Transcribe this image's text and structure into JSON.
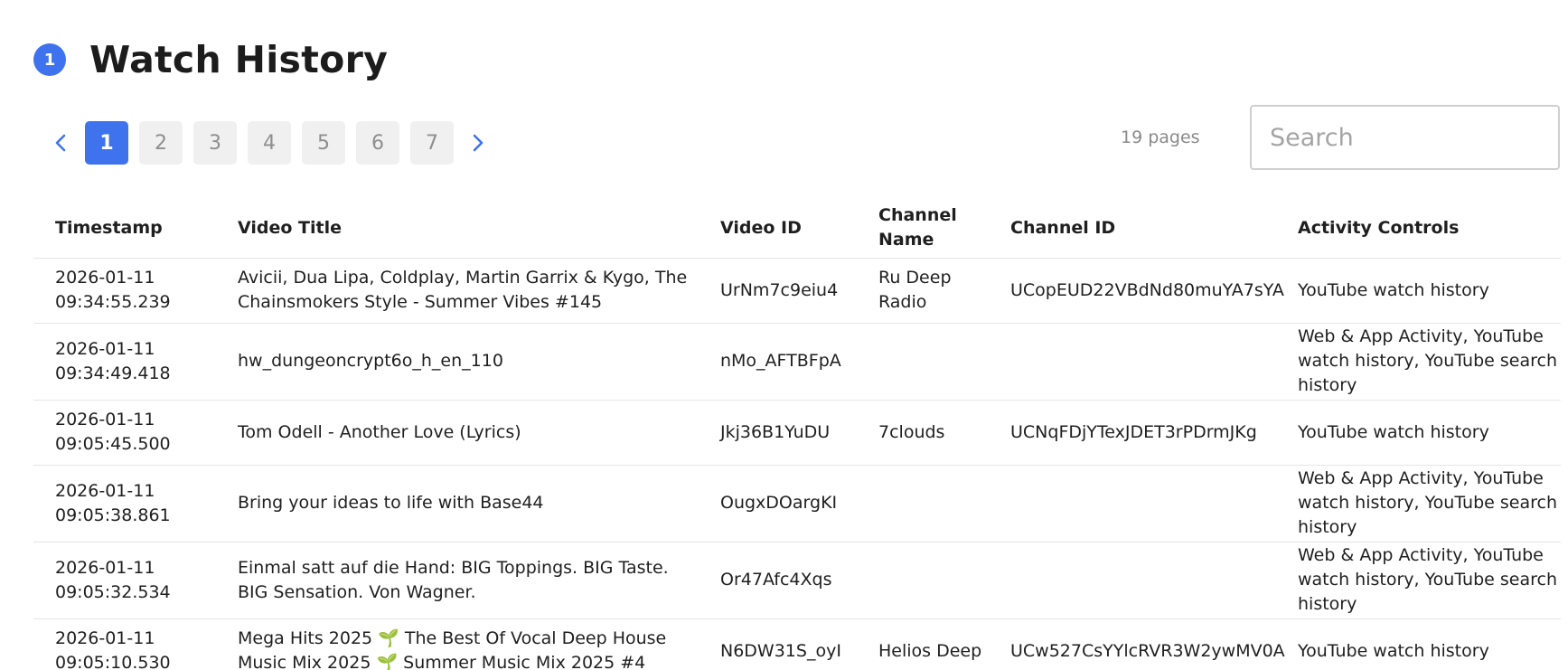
{
  "header": {
    "step": "1",
    "title": "Watch History"
  },
  "pagination": {
    "pages": [
      "1",
      "2",
      "3",
      "4",
      "5",
      "6",
      "7"
    ],
    "active_page": "1",
    "pages_count": "19 pages"
  },
  "search": {
    "placeholder": "Search",
    "value": ""
  },
  "colors": {
    "accent": "#3f73ee",
    "page_inactive_bg": "#f0f0f0"
  },
  "table": {
    "columns": [
      "Timestamp",
      "Video Title",
      "Video ID",
      "Channel Name",
      "Channel ID",
      "Activity Controls"
    ],
    "rows": [
      {
        "timestamp": "2026-01-11 09:34:55.239",
        "title": "Avicii, Dua Lipa, Coldplay, Martin Garrix & Kygo, The Chainsmokers Style - Summer Vibes #145",
        "video_id": "UrNm7c9eiu4",
        "channel_name": "Ru Deep Radio",
        "channel_id": "UCopEUD22VBdNd80muYA7sYA",
        "activity": "YouTube watch history"
      },
      {
        "timestamp": "2026-01-11 09:34:49.418",
        "title": "hw_dungeoncrypt6o_h_en_110",
        "video_id": "nMo_AFTBFpA",
        "channel_name": "",
        "channel_id": "",
        "activity": "Web & App Activity, YouTube watch history, YouTube search history"
      },
      {
        "timestamp": "2026-01-11 09:05:45.500",
        "title": "Tom Odell - Another Love (Lyrics)",
        "video_id": "Jkj36B1YuDU",
        "channel_name": "7clouds",
        "channel_id": "UCNqFDjYTexJDET3rPDrmJKg",
        "activity": "YouTube watch history"
      },
      {
        "timestamp": "2026-01-11 09:05:38.861",
        "title": "Bring your ideas to life with Base44",
        "video_id": "OugxDOargKI",
        "channel_name": "",
        "channel_id": "",
        "activity": "Web & App Activity, YouTube watch history, YouTube search history"
      },
      {
        "timestamp": "2026-01-11 09:05:32.534",
        "title": "Einmal satt auf die Hand: BIG Toppings. BIG Taste. BIG Sensation. Von Wagner.",
        "video_id": "Or47Afc4Xqs",
        "channel_name": "",
        "channel_id": "",
        "activity": "Web & App Activity, YouTube watch history, YouTube search history"
      },
      {
        "timestamp": "2026-01-11 09:05:10.530",
        "title": "Mega Hits 2025 🌱 The Best Of Vocal Deep House Music Mix 2025 🌱 Summer Music Mix 2025 #4",
        "video_id": "N6DW31S_oyI",
        "channel_name": "Helios Deep",
        "channel_id": "UCw527CsYYlcRVR3W2ywMV0A",
        "activity": "YouTube watch history"
      }
    ]
  }
}
